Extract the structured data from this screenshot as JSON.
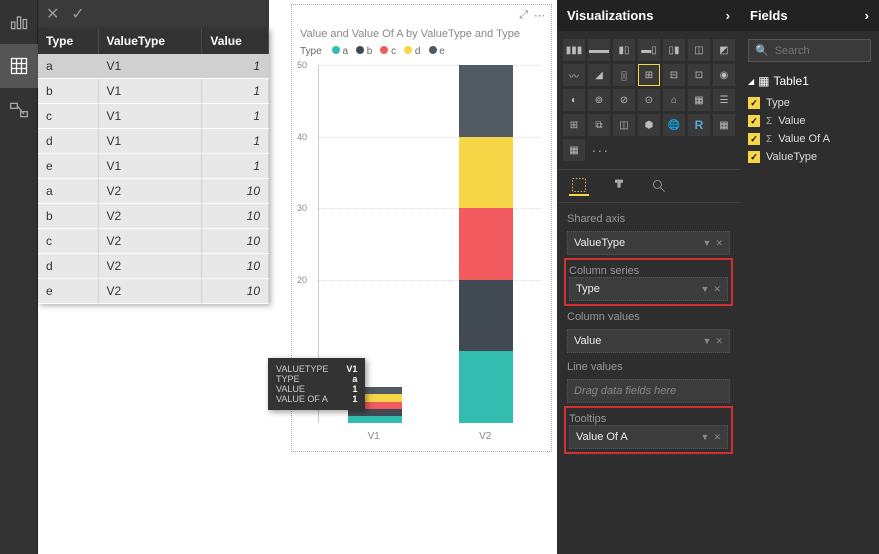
{
  "table": {
    "headers": [
      "Type",
      "ValueType",
      "Value"
    ],
    "rows": [
      [
        "a",
        "V1",
        "1"
      ],
      [
        "b",
        "V1",
        "1"
      ],
      [
        "c",
        "V1",
        "1"
      ],
      [
        "d",
        "V1",
        "1"
      ],
      [
        "e",
        "V1",
        "1"
      ],
      [
        "a",
        "V2",
        "10"
      ],
      [
        "b",
        "V2",
        "10"
      ],
      [
        "c",
        "V2",
        "10"
      ],
      [
        "d",
        "V2",
        "10"
      ],
      [
        "e",
        "V2",
        "10"
      ]
    ]
  },
  "chart_data": {
    "type": "bar",
    "title": "Value and Value Of A by ValueType and Type",
    "legend_label": "Type",
    "categories": [
      "V1",
      "V2"
    ],
    "series": [
      {
        "name": "a",
        "color": "#33bdb1",
        "values": [
          1,
          10
        ]
      },
      {
        "name": "b",
        "color": "#414a53",
        "values": [
          1,
          10
        ]
      },
      {
        "name": "c",
        "color": "#f15a5f",
        "values": [
          1,
          10
        ]
      },
      {
        "name": "d",
        "color": "#f6d646",
        "values": [
          1,
          10
        ]
      },
      {
        "name": "e",
        "color": "#4f5a63",
        "values": [
          1,
          10
        ]
      }
    ],
    "ylim": [
      0,
      50
    ],
    "yticks": [
      20,
      30,
      40,
      50
    ]
  },
  "tooltip": {
    "rows": [
      {
        "label": "VALUETYPE",
        "value": "V1"
      },
      {
        "label": "TYPE",
        "value": "a"
      },
      {
        "label": "VALUE",
        "value": "1"
      },
      {
        "label": "VALUE OF A",
        "value": "1"
      }
    ]
  },
  "viz": {
    "panel_title": "Visualizations",
    "row_labels": [
      "R",
      "..."
    ],
    "wells": {
      "shared_axis": {
        "label": "Shared axis",
        "value": "ValueType"
      },
      "column_series": {
        "label": "Column series",
        "value": "Type"
      },
      "column_values": {
        "label": "Column values",
        "value": "Value"
      },
      "line_values": {
        "label": "Line values",
        "placeholder": "Drag data fields here"
      },
      "tooltips": {
        "label": "Tooltips",
        "value": "Value Of A"
      }
    }
  },
  "fields": {
    "panel_title": "Fields",
    "search_placeholder": "Search",
    "table_name": "Table1",
    "items": [
      {
        "name": "Type",
        "checked": true,
        "sigma": false
      },
      {
        "name": "Value",
        "checked": true,
        "sigma": true
      },
      {
        "name": "Value Of A",
        "checked": true,
        "sigma": true
      },
      {
        "name": "ValueType",
        "checked": true,
        "sigma": false
      }
    ]
  }
}
